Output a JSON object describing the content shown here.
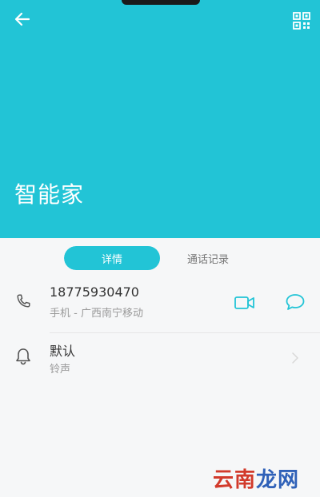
{
  "header": {
    "contact_name": "智能家",
    "bg_color": "#22c4d6"
  },
  "icons": {
    "back": "back-arrow-icon",
    "qr": "qr-code-icon",
    "phone": "phone-icon",
    "video": "video-call-icon",
    "message": "message-icon",
    "bell": "bell-icon",
    "chevron": "chevron-right-icon"
  },
  "tabs": [
    {
      "label": "详情",
      "active": true
    },
    {
      "label": "通话记录",
      "active": false
    }
  ],
  "phone_row": {
    "number": "18775930470",
    "label": "手机 - 广西南宁移动"
  },
  "ringtone_row": {
    "value": "默认",
    "label": "铃声"
  },
  "watermark": {
    "part1": "云南",
    "part2": "龙网"
  }
}
